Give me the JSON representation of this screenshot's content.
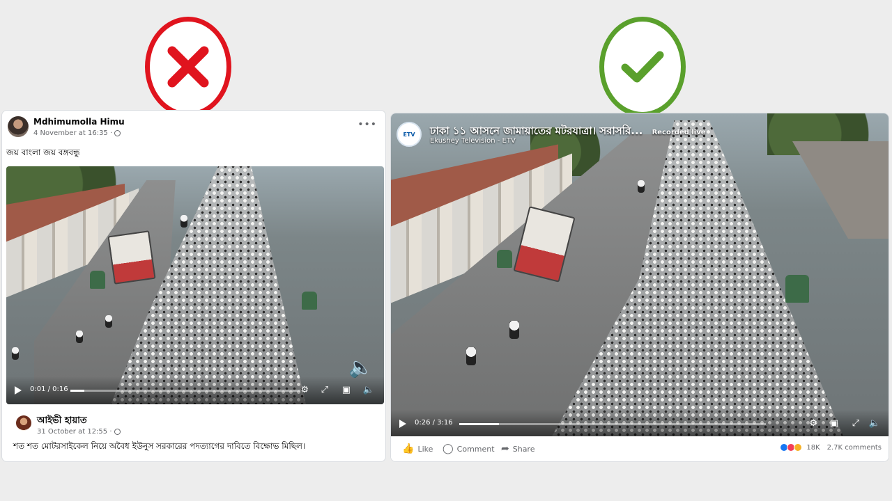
{
  "verdicts": {
    "wrong_icon": "cross-icon",
    "right_icon": "check-icon",
    "wrong_color": "#e0141e",
    "right_color": "#5aa02c"
  },
  "left_post": {
    "author": "Mdhimumolla Himu",
    "time": "4 November at 16:35 ·",
    "caption": "জয় বাংলা জয় বঙ্গবন্ধু",
    "video": {
      "time": "0:01 / 0:16",
      "progress": 0.06
    },
    "comment": {
      "author": "আইভী হায়াত",
      "time": "31 October at 12:55 ·",
      "text": "শত শত মোটরসাইকেল নিয়ে অবৈধ ইউনুস সরকারের পদত্যাগের দাবিতে বিক্ষোভ মিছিল।"
    }
  },
  "right_post": {
    "logo_text": "ETV",
    "title": "ঢাকা ১১ আসনে জামায়াতের মটরযাত্রা। সরাসরি...",
    "recorded_label": "Recorded live",
    "channel": "Ekushey Television - ETV",
    "video": {
      "time": "0:26 / 3:16",
      "progress": 0.13
    },
    "actions": {
      "like": "Like",
      "comment": "Comment",
      "share": "Share"
    },
    "reactions": {
      "count": "18K",
      "comments": "2.7K comments"
    }
  }
}
